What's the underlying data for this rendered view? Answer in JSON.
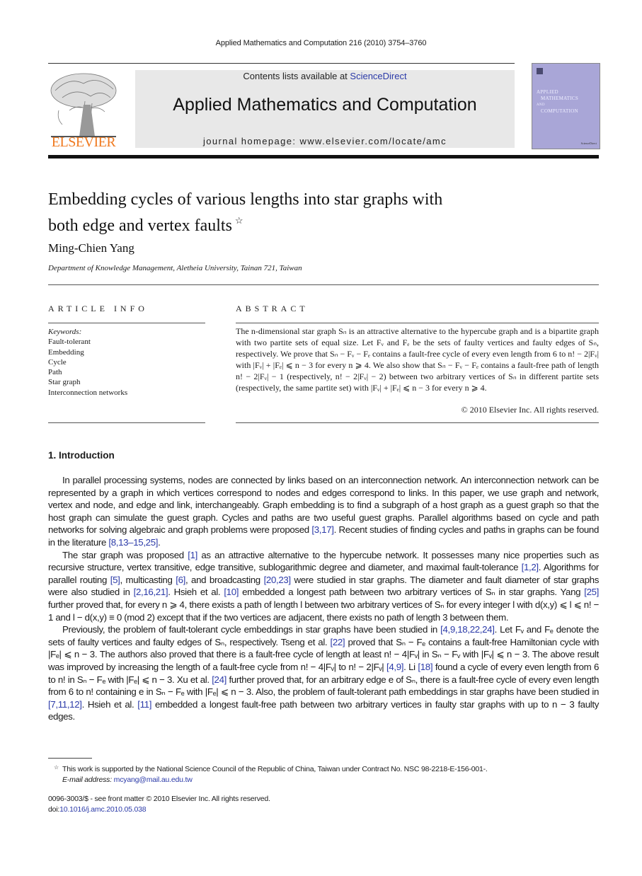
{
  "running_header": "Applied Mathematics and Computation 216 (2010) 3754–3760",
  "masthead": {
    "publisher_logo_text": "ELSEVIER",
    "contents_prefix": "Contents lists available at ",
    "contents_link": "ScienceDirect",
    "journal_title": "Applied Mathematics and Computation",
    "homepage": "journal homepage: www.elsevier.com/locate/amc",
    "cover_lines": [
      "APPLIED",
      "MATHEMATICS",
      "AND",
      "COMPUTATION"
    ],
    "colors": {
      "publisher_orange": "#f07a20",
      "link_blue": "#2b3aa8",
      "cover_purple": "#a9a6d7",
      "banner_gray": "#e8e8e8"
    }
  },
  "article": {
    "title_line1": "Embedding cycles of various lengths into star graphs with",
    "title_line2": "both edge and vertex faults",
    "title_footnote_mark": "☆",
    "author": "Ming-Chien Yang",
    "affiliation": "Department of Knowledge Management, Aletheia University, Tainan 721, Taiwan"
  },
  "article_info": {
    "heading": "ARTICLE INFO",
    "keywords_label": "Keywords:",
    "keywords": [
      "Fault-tolerant",
      "Embedding",
      "Cycle",
      "Path",
      "Star graph",
      "Interconnection networks"
    ]
  },
  "abstract": {
    "heading": "ABSTRACT",
    "text": "The n-dimensional star graph Sₙ is an attractive alternative to the hypercube graph and is a bipartite graph with two partite sets of equal size. Let Fᵥ and Fₑ be the sets of faulty vertices and faulty edges of Sₙ, respectively. We prove that Sₙ − Fᵥ − Fₑ contains a fault-free cycle of every even length from 6 to n! − 2|Fᵥ| with |Fᵥ| + |Fₑ| ⩽ n − 3 for every n ⩾ 4. We also show that Sₙ − Fᵥ − Fₑ contains a fault-free path of length n! − 2|Fᵥ| − 1 (respectively, n! − 2|Fᵥ| − 2) between two arbitrary vertices of Sₙ in different partite sets (respectively, the same partite set) with |Fᵥ| + |Fₑ| ⩽ n − 3 for every n ⩾ 4.",
    "copyright": "© 2010 Elsevier Inc. All rights reserved."
  },
  "section": {
    "heading": "1. Introduction",
    "paragraphs": [
      "In parallel processing systems, nodes are connected by links based on an interconnection network. An interconnection network can be represented by a graph in which vertices correspond to nodes and edges correspond to links. In this paper, we use graph and network, vertex and node, and edge and link, interchangeably. Graph embedding is to find a subgraph of a host graph as a guest graph so that the host graph can simulate the guest graph. Cycles and paths are two useful guest graphs. Parallel algorithms based on cycle and path networks for solving algebraic and graph problems were proposed [3,17]. Recent studies of finding cycles and paths in graphs can be found in the literature [8,13–15,25].",
      "The star graph was proposed [1] as an attractive alternative to the hypercube network. It possesses many nice properties such as recursive structure, vertex transitive, edge transitive, sublogarithmic degree and diameter, and maximal fault-tolerance [1,2]. Algorithms for parallel routing [5], multicasting [6], and broadcasting [20,23] were studied in star graphs. The diameter and fault diameter of star graphs were also studied in [2,16,21]. Hsieh et al. [10] embedded a longest path between two arbitrary vertices of Sₙ in star graphs. Yang [25] further proved that, for every n ⩾ 4, there exists a path of length l between two arbitrary vertices of Sₙ for every integer l with d(x,y) ⩽ l ⩽ n! − 1 and l − d(x,y) ≡ 0 (mod 2) except that if the two vertices are adjacent, there exists no path of length 3 between them.",
      "Previously, the problem of fault-tolerant cycle embeddings in star graphs have been studied in [4,9,18,22,24]. Let Fᵥ and Fₑ denote the sets of faulty vertices and faulty edges of Sₙ, respectively. Tseng et al. [22] proved that Sₙ − Fₑ contains a fault-free Hamiltonian cycle with |Fₑ| ⩽ n − 3. The authors also proved that there is a fault-free cycle of length at least n! − 4|Fᵥ| in Sₙ − Fᵥ with |Fᵥ| ⩽ n − 3. The above result was improved by increasing the length of a fault-free cycle from n! − 4|Fᵥ| to n! − 2|Fᵥ| [4,9]. Li [18] found a cycle of every even length from 6 to n! in Sₙ − Fₑ with |Fₑ| ⩽ n − 3. Xu et al. [24] further proved that, for an arbitrary edge e of Sₙ, there is a fault-free cycle of every even length from 6 to n! containing e in Sₙ − Fₑ with |Fₑ| ⩽ n − 3. Also, the problem of fault-tolerant path embeddings in star graphs have been studied in [7,11,12]. Hsieh et al. [11] embedded a longest fault-free path between two arbitrary vertices in faulty star graphs with up to n − 3 faulty edges."
    ]
  },
  "footnotes": {
    "mark": "☆",
    "funding": "This work is supported by the National Science Council of the Republic of China, Taiwan under Contract No. NSC 98-2218-E-156-001-.",
    "email_label": "E-mail address:",
    "email": "mcyang@mail.au.edu.tw",
    "issn_line": "0096-3003/$ - see front matter © 2010 Elsevier Inc. All rights reserved.",
    "doi_prefix": "doi:",
    "doi": "10.1016/j.amc.2010.05.038"
  }
}
